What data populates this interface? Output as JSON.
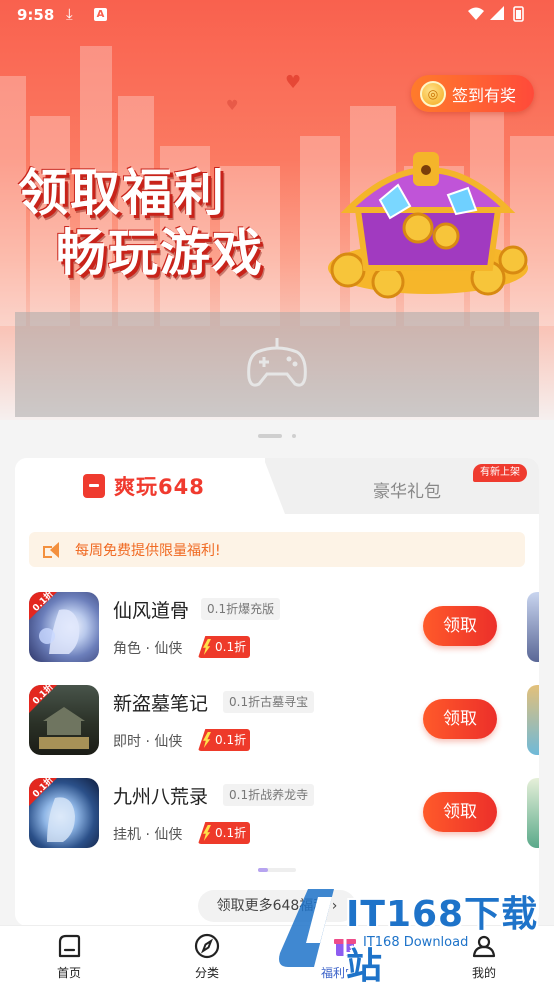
{
  "status_bar": {
    "time": "9:58",
    "download_icon": "download-icon",
    "badge": "A"
  },
  "banner": {
    "signin_label": "签到有奖",
    "title_line1": "领取福利",
    "title_line2": "畅玩游戏"
  },
  "card": {
    "tab_active": "爽玩648",
    "tab_inactive": "豪华礼包",
    "new_badge": "有新上架",
    "notice": "每周免费提供限量福利!",
    "games": [
      {
        "name": "仙风道骨",
        "tag": "0.1折爆充版",
        "meta": "角色 · 仙侠",
        "discount": "0.1折",
        "corner": "0.1折",
        "claim": "领取"
      },
      {
        "name": "新盗墓笔记",
        "tag": "0.1折古墓寻宝",
        "meta": "即时 · 仙侠",
        "discount": "0.1折",
        "corner": "0.1折",
        "claim": "领取"
      },
      {
        "name": "九州八荒录",
        "tag": "0.1折战养龙寺",
        "meta": "挂机 · 仙侠",
        "discount": "0.1折",
        "corner": "0.1折",
        "claim": "领取"
      }
    ],
    "more_label": "领取更多648福利 ›"
  },
  "bottom_nav": [
    {
      "label": "首页"
    },
    {
      "label": "分类"
    },
    {
      "label": "福利中心"
    },
    {
      "label": "我的"
    }
  ],
  "watermark": {
    "logo": "IT168下载站",
    "sub": "IT168 Download"
  },
  "colors": {
    "accent": "#f03b2f",
    "banner": "#f9614e",
    "notice_text": "#f06a23"
  }
}
